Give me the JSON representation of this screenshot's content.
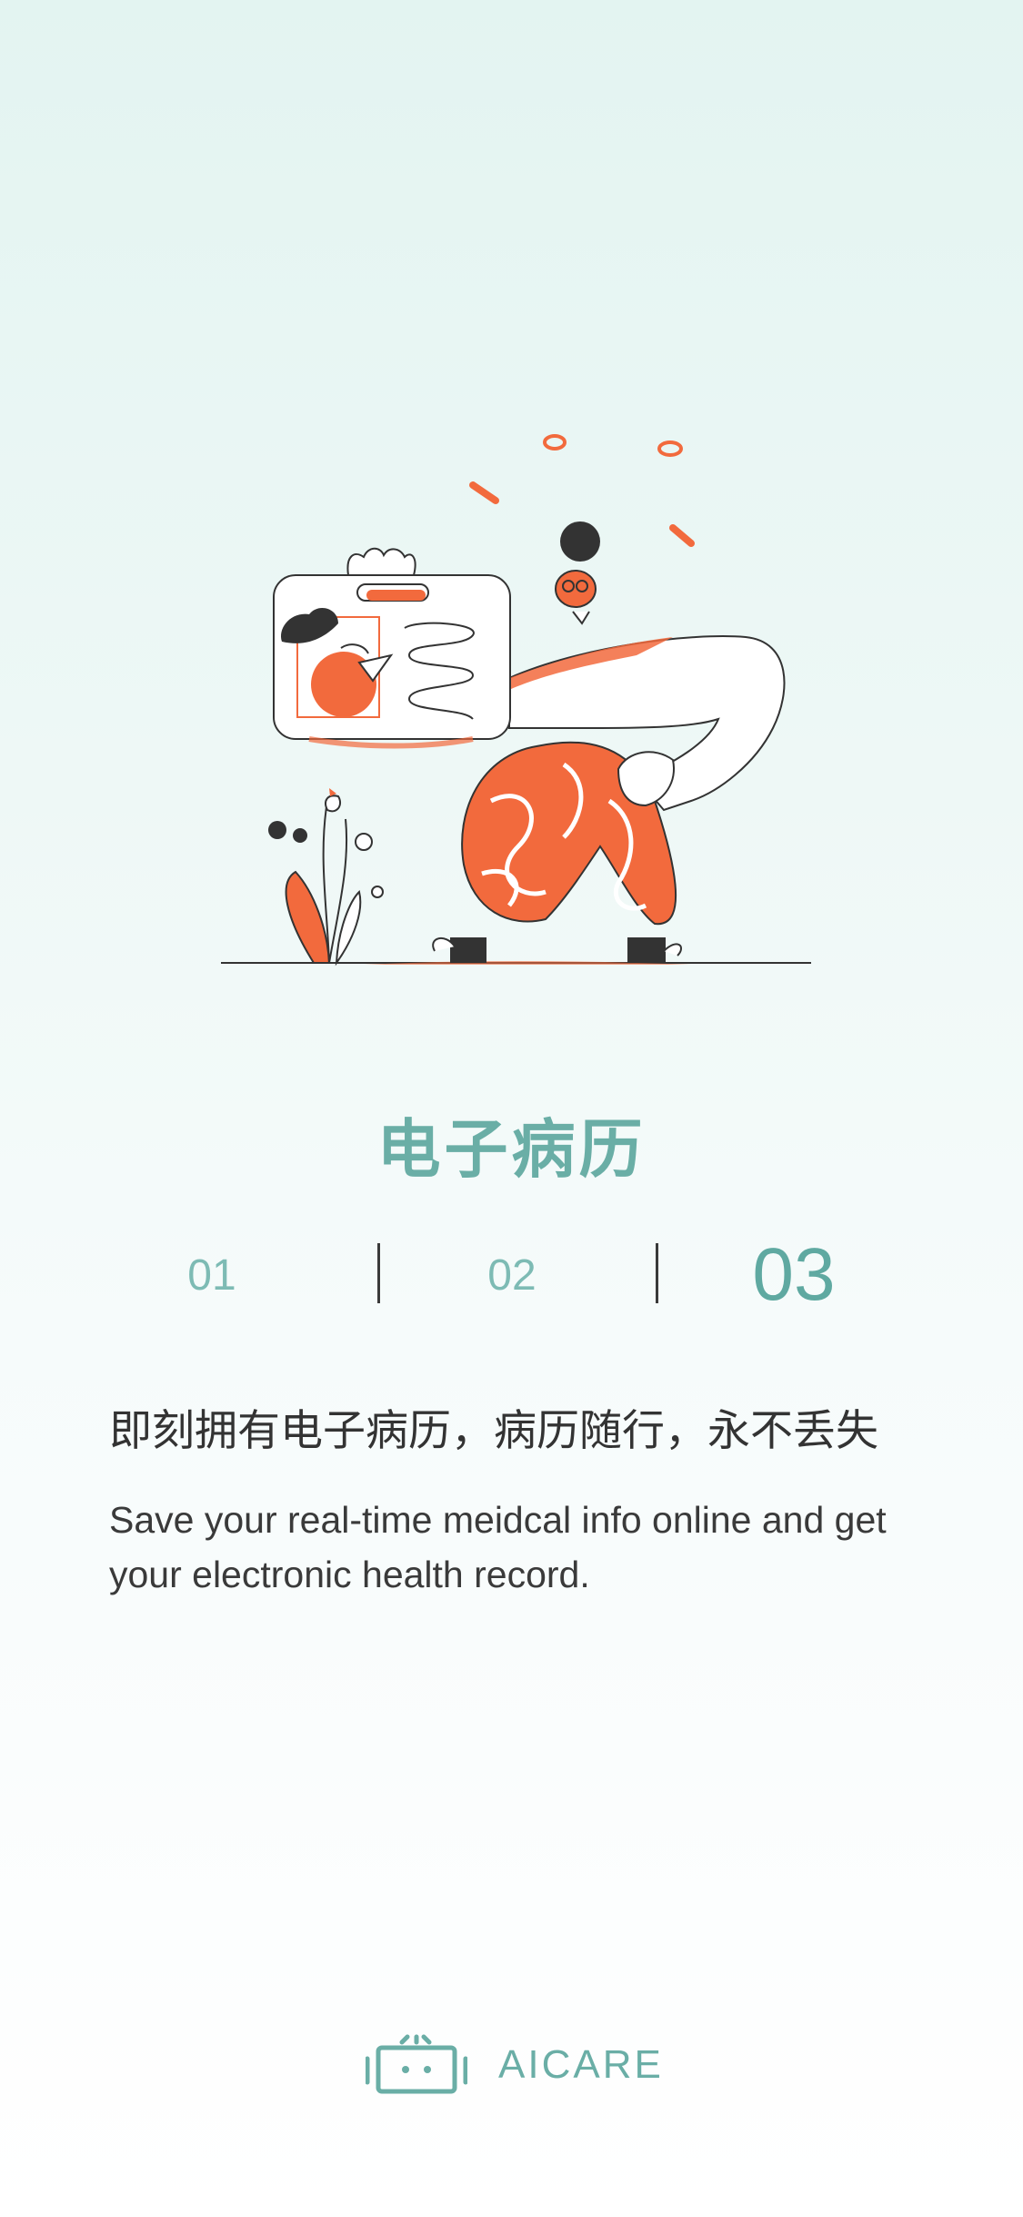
{
  "onboarding": {
    "title": "电子病历",
    "steps": [
      "01",
      "02",
      "03"
    ],
    "active_step": 3,
    "description_cn": "即刻拥有电子病历，病历随行，永不丢失",
    "description_en": "Save your real-time meidcal info online and get your electronic health record."
  },
  "brand": {
    "name": "AICARE",
    "logo_icon": "robot-face-icon"
  },
  "illustration": {
    "name": "medical-record-illustration"
  },
  "colors": {
    "accent": "#6aaea6",
    "illustration_orange": "#f26a3d"
  }
}
